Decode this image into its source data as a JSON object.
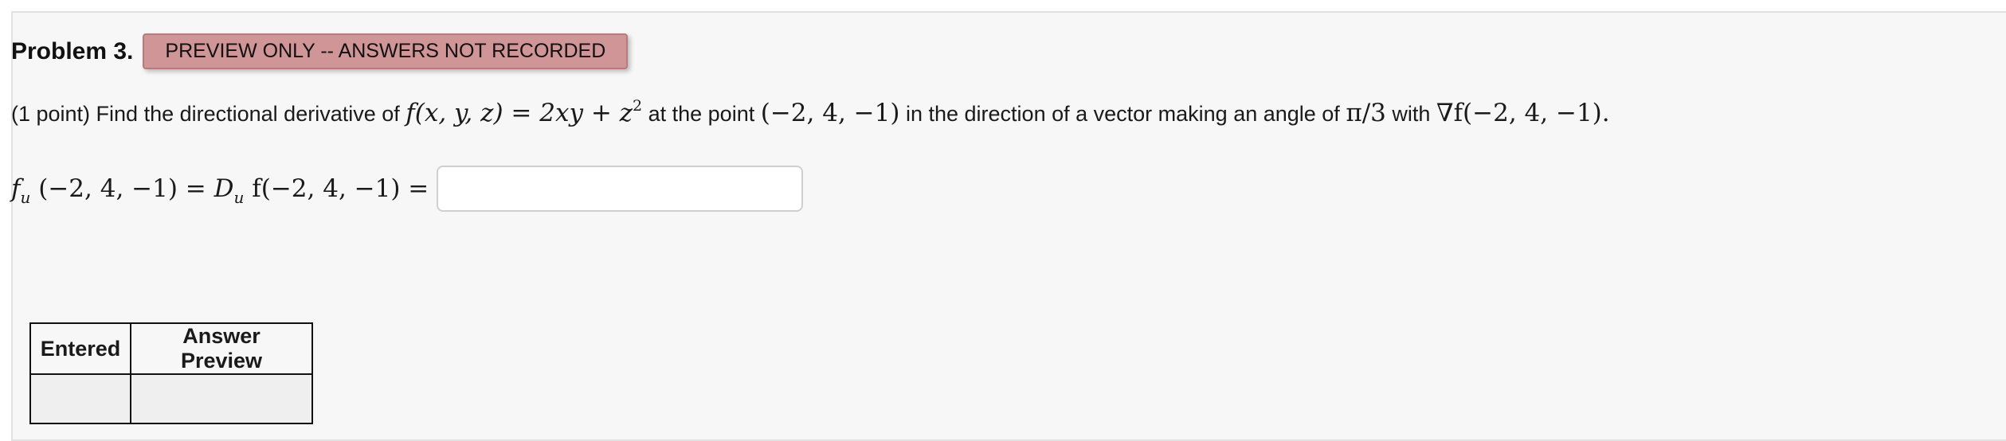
{
  "problem": {
    "title": "Problem 3.",
    "badge": "PREVIEW ONLY -- ANSWERS NOT RECORDED",
    "statement": {
      "prefix": "(1 point) Find the directional derivative of",
      "function_lhs": "f(x, y, z) = 2xy + z",
      "function_exp": "2",
      "mid": "at the point",
      "point": "(−2, 4, −1)",
      "direction_text": "in the direction of a vector making an angle of",
      "angle": "π/3",
      "with_text": "with",
      "gradient": "∇f(−2, 4, −1)."
    },
    "answer": {
      "lhs_f": "f",
      "lhs_sub": "u",
      "lhs_point": "(−2, 4, −1) = ",
      "rhs_D": "D",
      "rhs_sub": "u",
      "rhs_rest": " f(−2, 4, −1) =",
      "value": "",
      "placeholder": ""
    }
  },
  "results_table": {
    "headers": [
      "Entered",
      "Answer Preview"
    ],
    "rows": [
      [
        "",
        ""
      ]
    ]
  }
}
